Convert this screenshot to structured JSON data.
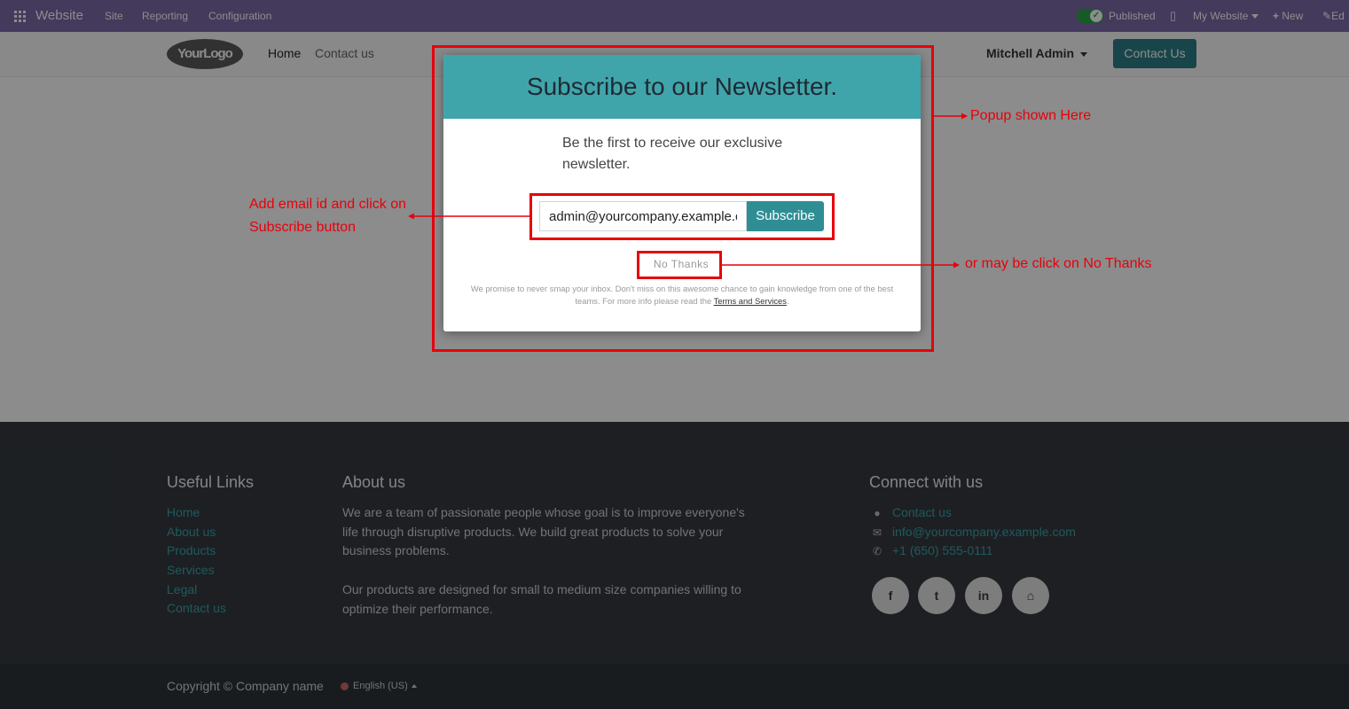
{
  "adminbar": {
    "app_name": "Website",
    "menu": [
      "Site",
      "Reporting",
      "Configuration"
    ],
    "published_label": "Published",
    "website_selector": "My Website",
    "new_label": "New",
    "edit_label": "Ed"
  },
  "header": {
    "logo_text": "YourLogo",
    "nav": [
      "Home",
      "Contact us"
    ],
    "user_name": "Mitchell Admin",
    "cta_label": "Contact Us"
  },
  "popup": {
    "title": "Subscribe to our Newsletter.",
    "description": "Be the first to receive our exclusive newsletter.",
    "email_value": "admin@yourcompany.example.com",
    "subscribe_label": "Subscribe",
    "no_thanks_label": "No Thanks",
    "fine_print": "We promise to never smap your inbox. Don't miss on this awesome chance to gain knowledge from one of the best teams. For more info please read the ",
    "terms_label": "Terms and Services",
    "fine_print_end": "."
  },
  "annotations": {
    "popup_label": "Popup shown Here",
    "email_label_line1": "Add email id and click on",
    "email_label_line2": "Subscribe button",
    "no_thanks_label": "or may be click on No Thanks",
    "color": "#e8000b"
  },
  "footer": {
    "useful_links_title": "Useful Links",
    "useful_links": [
      "Home",
      "About us",
      "Products",
      "Services",
      "Legal",
      "Contact us"
    ],
    "about_title": "About us",
    "about_para1": "We are a team of passionate people whose goal is to improve everyone's life through disruptive products. We build great products to solve your business problems.",
    "about_para2": "Our products are designed for small to medium size companies willing to optimize their performance.",
    "connect_title": "Connect with us",
    "contact_link": "Contact us",
    "email": "info@yourcompany.example.com",
    "phone": "+1 (650) 555-0111",
    "social_icons": [
      "facebook-icon",
      "twitter-icon",
      "linkedin-icon",
      "home-icon"
    ],
    "social_glyphs": [
      "f",
      "t",
      "in",
      "⌂"
    ],
    "copyright": "Copyright © Company name",
    "language": "English (US)"
  },
  "colors": {
    "adminbar": "#7c6ba8",
    "teal": "#2c7f86",
    "popup_header": "#40a5ab",
    "footer_bg": "#353a40"
  }
}
